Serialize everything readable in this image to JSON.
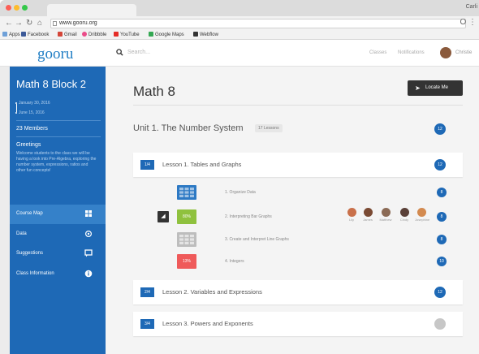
{
  "browser": {
    "user": "Carli",
    "url": "www.gooru.org",
    "bookmarks": [
      "Apps",
      "Facebook",
      "Gmail",
      "Dribbble",
      "YouTube",
      "Google Maps",
      "Webflow"
    ]
  },
  "header": {
    "logo": "gooru",
    "search_placeholder": "Search...",
    "links": [
      "Classes",
      "Notifications"
    ],
    "user_name": "Christie"
  },
  "sidebar": {
    "class_name": "Math 8 Block 2",
    "dates": [
      "January 30, 2016",
      "June 15, 2016"
    ],
    "members": "23 Members",
    "greetings_title": "Greetings",
    "greetings_text": "Welcome students to the class we will be having a look into Pre-Algebra, exploring the number system, expressions, ratios and other fun concepts!",
    "nav": [
      {
        "label": "Course Map",
        "icon": "course-map-icon",
        "active": true
      },
      {
        "label": "Data",
        "icon": "data-icon",
        "active": false
      },
      {
        "label": "Suggestions",
        "icon": "suggestions-icon",
        "active": false
      },
      {
        "label": "Class Information",
        "icon": "info-icon",
        "active": false
      }
    ]
  },
  "main": {
    "title": "Math 8",
    "locate_button": "Locate Me",
    "unit": {
      "title": "Unit 1. The Number System",
      "badge": "17 Lessons",
      "count": "12"
    },
    "lessons": [
      {
        "badge": "1/4",
        "title": "Lesson 1. Tables and Graphs",
        "count": "12"
      },
      {
        "badge": "2/4",
        "title": "Lesson 2. Variables and Expressions",
        "count": "12"
      },
      {
        "badge": "3/4",
        "title": "Lesson 3. Powers and Exponents",
        "count": ""
      }
    ],
    "resources": [
      {
        "label": "1. Organize Data",
        "tile": "",
        "count": "8"
      },
      {
        "label": "2. Interpreting Bar Graphs",
        "tile": "80%",
        "count": "8"
      },
      {
        "label": "3. Create and Interpret Line Graphs",
        "tile": "",
        "count": "8"
      },
      {
        "label": "4. Integers",
        "tile": "13%",
        "count": "10"
      }
    ],
    "students": [
      "Lily",
      "James",
      "Matthew",
      "Cindy",
      "Josephine"
    ]
  },
  "colors": {
    "brand_blue": "#1e69b6",
    "active_nav": "#3581c9",
    "score_green": "#8fc13e",
    "score_red": "#ef5a5a",
    "dark_button": "#333333"
  }
}
